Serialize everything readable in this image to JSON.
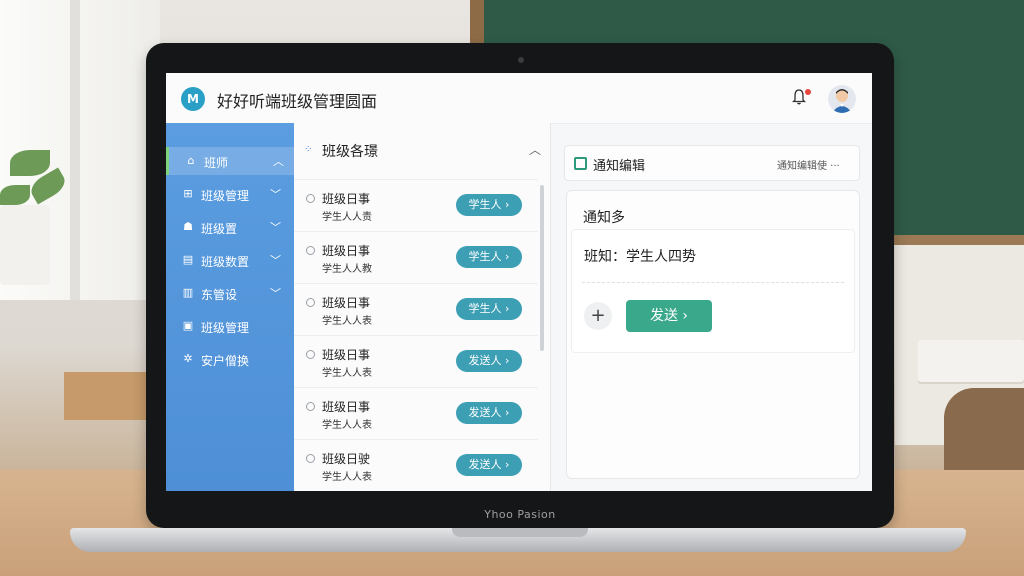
{
  "app": {
    "title": "好好听端班级管理圆面",
    "logo_text": "M"
  },
  "sidebar": {
    "items": [
      {
        "label": "班师",
        "icon": "home-icon",
        "glyph": "⌂",
        "caret": "︿"
      },
      {
        "label": "班级管理",
        "icon": "grid-icon",
        "glyph": "⊞",
        "caret": "﹀"
      },
      {
        "label": "班级置",
        "icon": "users-icon",
        "glyph": "☗",
        "caret": "﹀"
      },
      {
        "label": "班级数置",
        "icon": "chart-icon",
        "glyph": "▤",
        "caret": "﹀"
      },
      {
        "label": "东管设",
        "icon": "book-icon",
        "glyph": "▥",
        "caret": "﹀"
      },
      {
        "label": "班级管理",
        "icon": "lock-icon",
        "glyph": "▣",
        "caret": ""
      },
      {
        "label": "安户僧换",
        "icon": "gear-icon",
        "glyph": "✲",
        "caret": ""
      }
    ]
  },
  "class_list": {
    "title": "班级各璟",
    "rows": [
      {
        "title": "班级日事",
        "subtitle": "学生人人责",
        "button": "学生人 ›"
      },
      {
        "title": "班级日事",
        "subtitle": "学生人人教",
        "button": "学生人 ›"
      },
      {
        "title": "班级日事",
        "subtitle": "学生人人表",
        "button": "学生人 ›"
      },
      {
        "title": "班级日事",
        "subtitle": "学生人人表",
        "button": "发送人 ›"
      },
      {
        "title": "班级日事",
        "subtitle": "学生人人表",
        "button": "发送人 ›"
      },
      {
        "title": "班级日驶",
        "subtitle": "学生人人表",
        "button": "发送人 ›"
      }
    ]
  },
  "notification": {
    "header_title": "通知编辑",
    "header_action": "通知编辑使 ···",
    "subtitle": "通知多",
    "content": "班知：学生人四势",
    "add_label": "+",
    "send_label": "发送  ›"
  },
  "device": {
    "brand": "Yhoo Pasion"
  },
  "colors": {
    "sidebar": "#5b9de0",
    "primary_button": "#3d9fb4",
    "send_button": "#3aa88b"
  }
}
